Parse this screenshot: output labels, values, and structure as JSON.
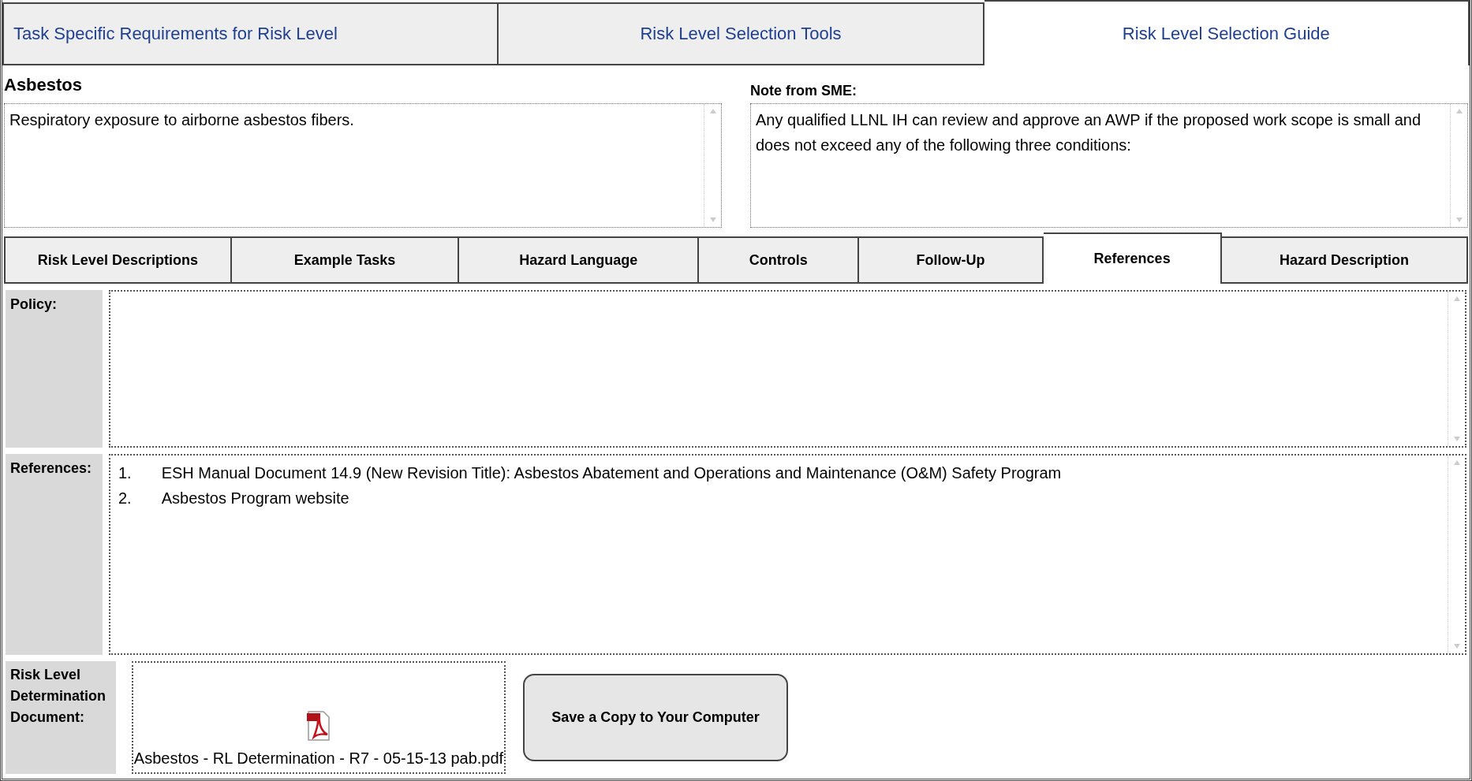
{
  "top_tabs": [
    {
      "label": "Task Specific Requirements for Risk Level",
      "selected": false
    },
    {
      "label": "Risk Level Selection Tools",
      "selected": false
    },
    {
      "label": "Risk Level Selection Guide",
      "selected": true
    }
  ],
  "hazard": {
    "title": "Asbestos",
    "description": "Respiratory exposure to airborne asbestos fibers."
  },
  "sme_note": {
    "label": "Note from SME:",
    "text": "Any qualified LLNL IH can review and approve an AWP if the proposed work scope is small and does not exceed any of the following three conditions:"
  },
  "detail_tabs": [
    {
      "label": "Risk Level Descriptions",
      "selected": false
    },
    {
      "label": "Example Tasks",
      "selected": false
    },
    {
      "label": "Hazard Language",
      "selected": false
    },
    {
      "label": "Controls",
      "selected": false
    },
    {
      "label": "Follow-Up",
      "selected": false
    },
    {
      "label": "References",
      "selected": true
    },
    {
      "label": "Hazard Description",
      "selected": false
    }
  ],
  "policy": {
    "label": "Policy:"
  },
  "references": {
    "label": "References:",
    "items": [
      {
        "number": "1.",
        "text": "ESH Manual Document 14.9 (New Revision Title): Asbestos Abatement and Operations and Maintenance (O&M) Safety Program"
      },
      {
        "number": "2.",
        "text": "Asbestos Program website"
      }
    ]
  },
  "document": {
    "label": "Risk Level Determination Document:",
    "file_name": "Asbestos - RL Determination - R7 - 05-15-13 pab.pdf",
    "save_button": "Save a Copy to Your Computer"
  }
}
